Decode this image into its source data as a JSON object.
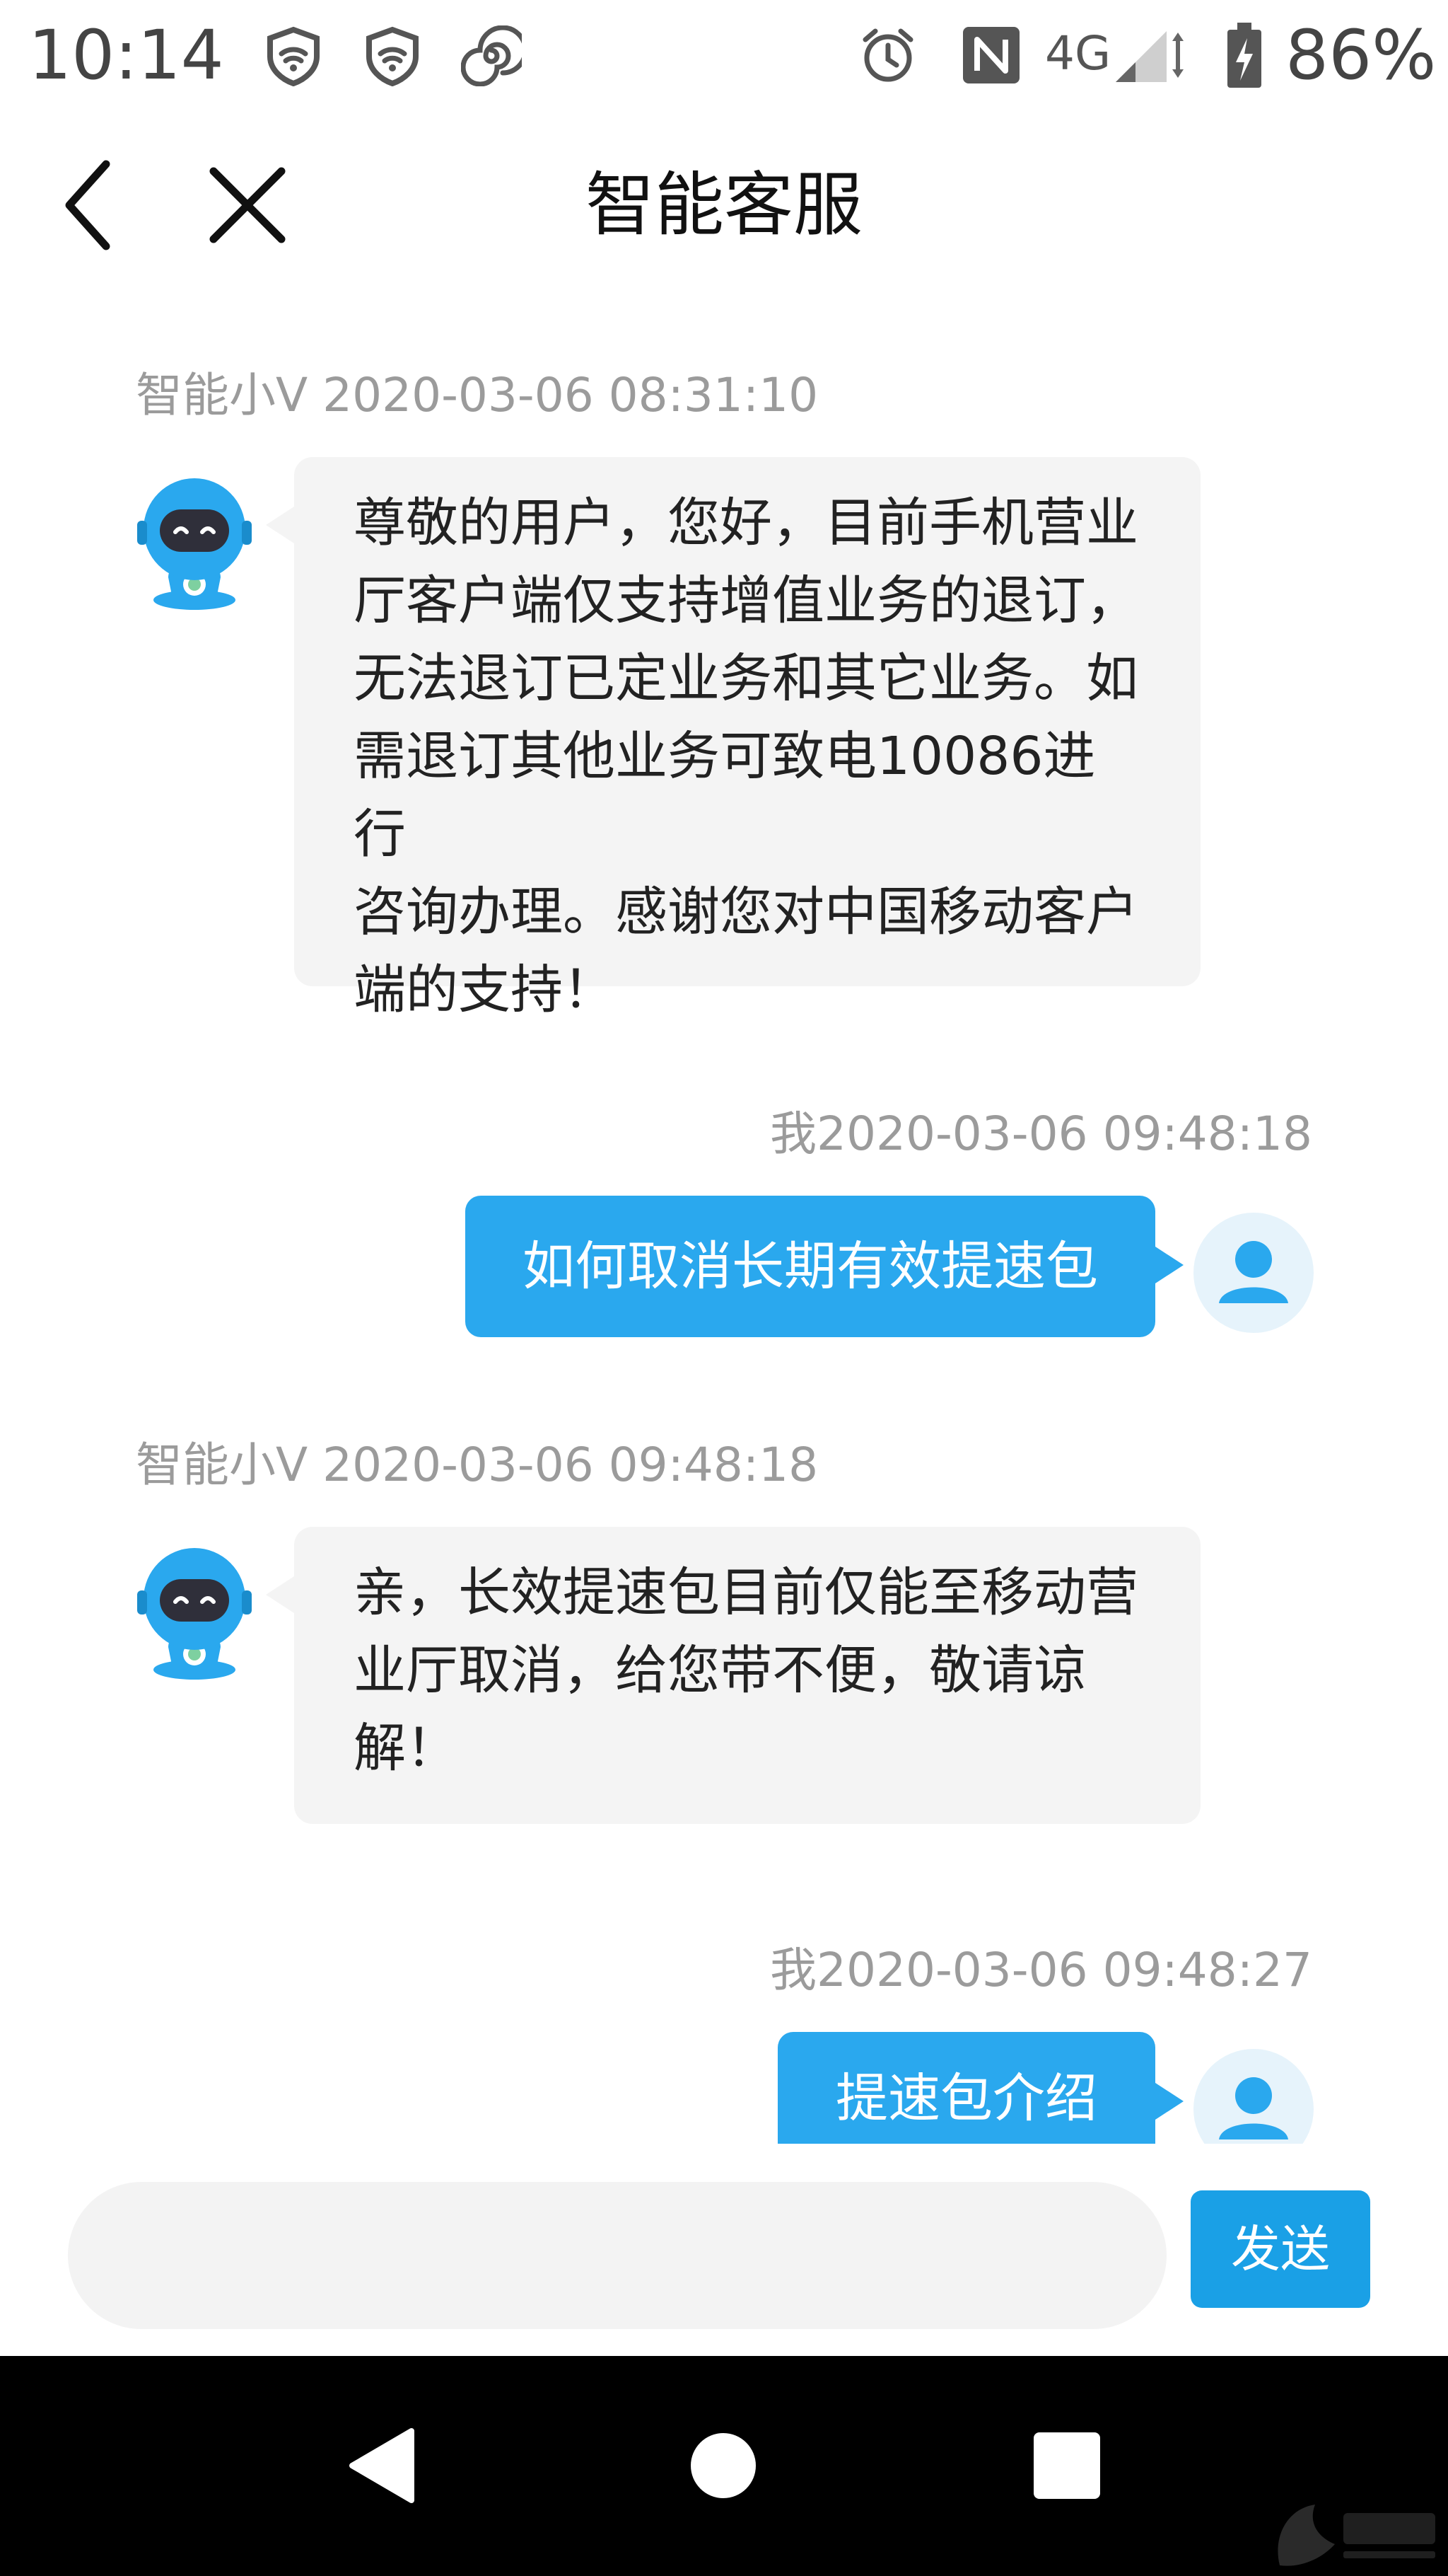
{
  "status_bar": {
    "time": "10:14",
    "network": "4G",
    "battery": "86%"
  },
  "header": {
    "title": "智能客服"
  },
  "messages": [
    {
      "sender": "bot",
      "meta": "智能小V 2020-03-06 08:31:10",
      "lines": [
        "尊敬的用户，您好，目前手机营业",
        "厅客户端仅支持增值业务的退订，",
        "无法退订已定业务和其它业务。如",
        "需退订其他业务可致电10086进行",
        "咨询办理。感谢您对中国移动客户",
        "端的支持！"
      ]
    },
    {
      "sender": "user",
      "meta": "我2020-03-06 09:48:18",
      "text": "如何取消长期有效提速包"
    },
    {
      "sender": "bot",
      "meta": "智能小V 2020-03-06 09:48:18",
      "lines": [
        "亲，长效提速包目前仅能至移动营",
        "业厅取消，给您带不便，敬请谅",
        "解！"
      ]
    },
    {
      "sender": "user",
      "meta": "我2020-03-06 09:48:27",
      "text": "提速包介绍"
    }
  ],
  "input": {
    "value": "",
    "send_label": "发送"
  },
  "colors": {
    "user_bubble": "#2aa8ee",
    "bot_bubble": "#f4f4f4",
    "send_button": "#1aa0e6",
    "timestamp": "#9b9b9b"
  }
}
